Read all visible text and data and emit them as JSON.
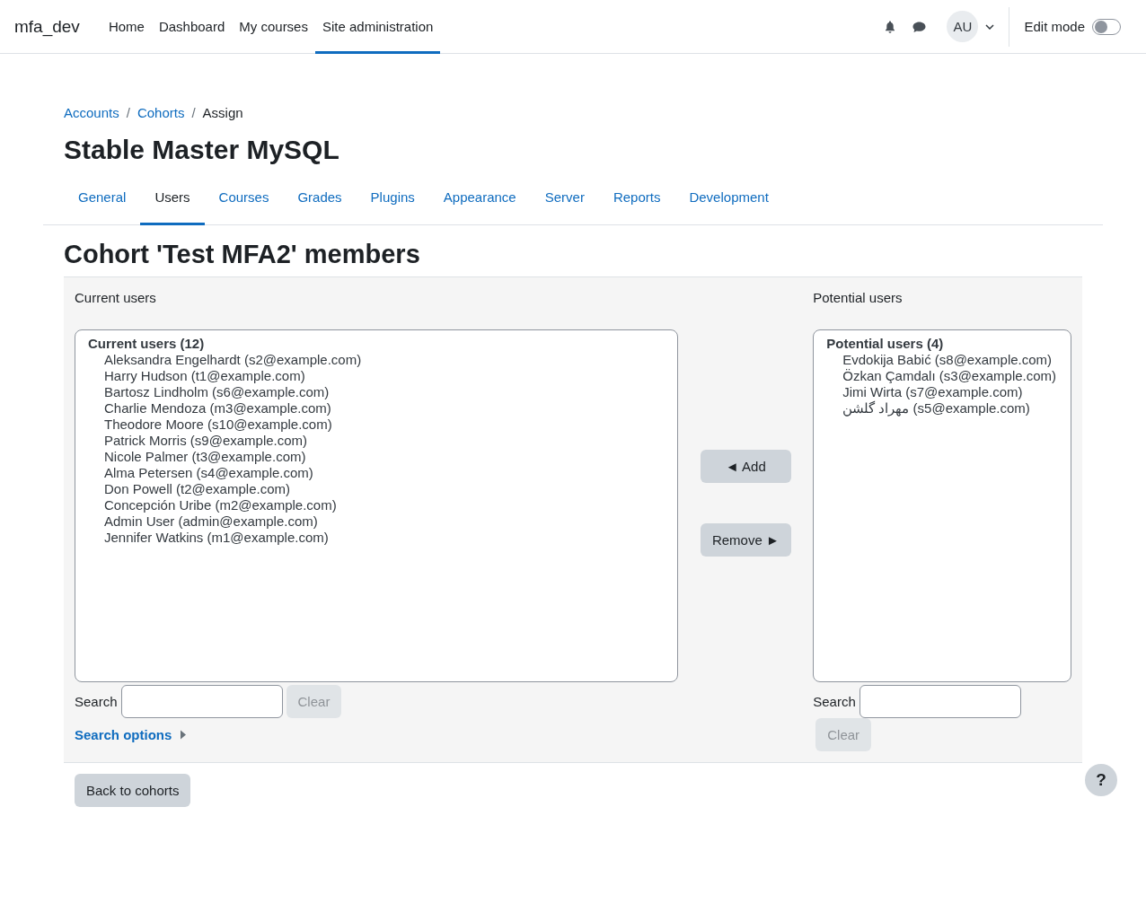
{
  "navbar": {
    "site_name": "mfa_dev",
    "items": [
      {
        "label": "Home",
        "selected": false
      },
      {
        "label": "Dashboard",
        "selected": false
      },
      {
        "label": "My courses",
        "selected": false
      },
      {
        "label": "Site administration",
        "selected": true
      }
    ],
    "avatar": "AU",
    "edit_mode": {
      "label": "Edit mode",
      "on": false
    }
  },
  "breadcrumbs": [
    {
      "label": "Accounts",
      "kind": "link"
    },
    {
      "label": "/",
      "kind": "separator"
    },
    {
      "label": "Cohorts",
      "kind": "link"
    },
    {
      "label": "/",
      "kind": "separator"
    },
    {
      "label": "Assign",
      "kind": "current"
    }
  ],
  "page_title": "Stable Master MySQL",
  "tabs": [
    {
      "label": "General",
      "selected": false
    },
    {
      "label": "Users",
      "selected": true
    },
    {
      "label": "Courses",
      "selected": false
    },
    {
      "label": "Grades",
      "selected": false
    },
    {
      "label": "Plugins",
      "selected": false
    },
    {
      "label": "Appearance",
      "selected": false
    },
    {
      "label": "Server",
      "selected": false
    },
    {
      "label": "Reports",
      "selected": false
    },
    {
      "label": "Development",
      "selected": false
    }
  ],
  "heading": "Cohort 'Test MFA2' members",
  "current": {
    "label": "Current users",
    "group": "Current users (12)",
    "users": [
      "Aleksandra Engelhardt (s2@example.com)",
      "Harry Hudson (t1@example.com)",
      "Bartosz Lindholm (s6@example.com)",
      "Charlie Mendoza (m3@example.com)",
      "Theodore Moore (s10@example.com)",
      "Patrick Morris (s9@example.com)",
      "Nicole Palmer (t3@example.com)",
      "Alma Petersen (s4@example.com)",
      "Don Powell (t2@example.com)",
      "Concepción Uribe (m2@example.com)",
      "Admin User (admin@example.com)",
      "Jennifer Watkins (m1@example.com)"
    ],
    "search_label": "Search",
    "clear": {
      "label": "Clear",
      "disabled": true
    },
    "search_options": "Search options"
  },
  "actions": [
    "◄ Add",
    "Remove ►"
  ],
  "potential": {
    "label": "Potential users",
    "group": "Potential users (4)",
    "users": [
      "Evdokija Babić (s8@example.com)",
      "Özkan Çamdalı (s3@example.com)",
      "Jimi Wirta (s7@example.com)",
      "مهراد گلشن (s5@example.com)"
    ],
    "search_label": "Search",
    "clear": {
      "label": "Clear",
      "disabled": true
    }
  },
  "back_button": "Back to cohorts",
  "help": "?"
}
